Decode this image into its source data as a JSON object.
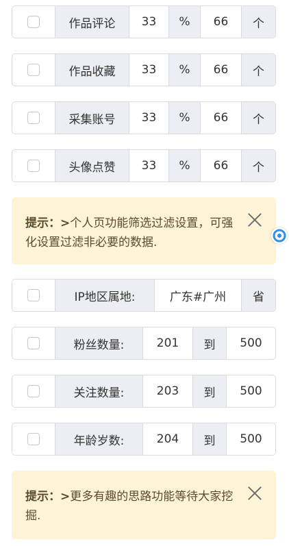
{
  "group1": [
    {
      "label": "作品评论",
      "min": "33",
      "sep": "%",
      "max": "66",
      "unit": "个"
    },
    {
      "label": "作品收藏",
      "min": "33",
      "sep": "%",
      "max": "66",
      "unit": "个"
    },
    {
      "label": "采集账号",
      "min": "33",
      "sep": "%",
      "max": "66",
      "unit": "个"
    },
    {
      "label": "头像点赞",
      "min": "33",
      "sep": "%",
      "max": "66",
      "unit": "个"
    }
  ],
  "notice1": {
    "prefix": "提示：>",
    "text": "个人页功能筛选过滤设置，可强化设置过滤非必要的数据."
  },
  "ip": {
    "label": "IP地区属地:",
    "value": "广东#广州",
    "unit": "省"
  },
  "group2": [
    {
      "label": "粉丝数量:",
      "min": "201",
      "sep": "到",
      "max": "500"
    },
    {
      "label": "关注数量:",
      "min": "203",
      "sep": "到",
      "max": "500"
    },
    {
      "label": "年龄岁数:",
      "min": "204",
      "sep": "到",
      "max": "500"
    }
  ],
  "notice2": {
    "prefix": "提示：>",
    "text": "更多有趣的思路功能等待大家挖掘."
  }
}
